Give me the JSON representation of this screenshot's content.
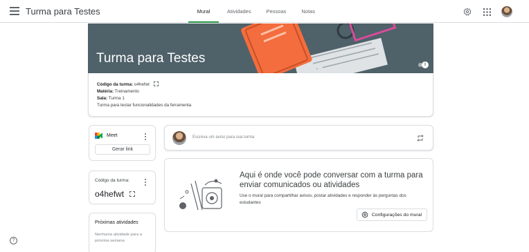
{
  "header": {
    "app_title": "Turma para Testes",
    "tabs": [
      {
        "label": "Mural",
        "active": true
      },
      {
        "label": "Atividades",
        "active": false
      },
      {
        "label": "Pessoas",
        "active": false
      },
      {
        "label": "Notas",
        "active": false
      }
    ],
    "icons": [
      "menu-icon",
      "settings-gear-icon",
      "apps-grid-icon",
      "avatar"
    ]
  },
  "banner": {
    "title": "Turma para Testes",
    "info_icon": "i"
  },
  "class_info": {
    "code_label": "Código da turma:",
    "code_value": "o4hefwt",
    "subject_label": "Matéria:",
    "subject_value": "Treinamento",
    "room_label": "Sala:",
    "room_value": "Turma 1",
    "description": "Turma para testar funcionalidades da ferramenta"
  },
  "meet": {
    "label": "Meet",
    "button": "Gerar link"
  },
  "class_code_card": {
    "label": "Código da turma:",
    "value": "o4hefwt"
  },
  "upcoming": {
    "title": "Próximas atividades",
    "text": "Nenhuma atividade para a próxima semana"
  },
  "post_box": {
    "placeholder": "Escreva um aviso para sua turma"
  },
  "empty_state": {
    "title": "Aqui é onde você pode conversar com a turma para enviar comunicados ou atividades",
    "description": "Use o mural para compartilhar avisos, postar atividades e responder às perguntas dos estudantes",
    "button": "Configurações do mural"
  },
  "help": "?",
  "colors": {
    "accent": "#1e8e3e",
    "banner_bg": "#4f6169",
    "border": "#dadce0",
    "text": "#3c4043"
  }
}
